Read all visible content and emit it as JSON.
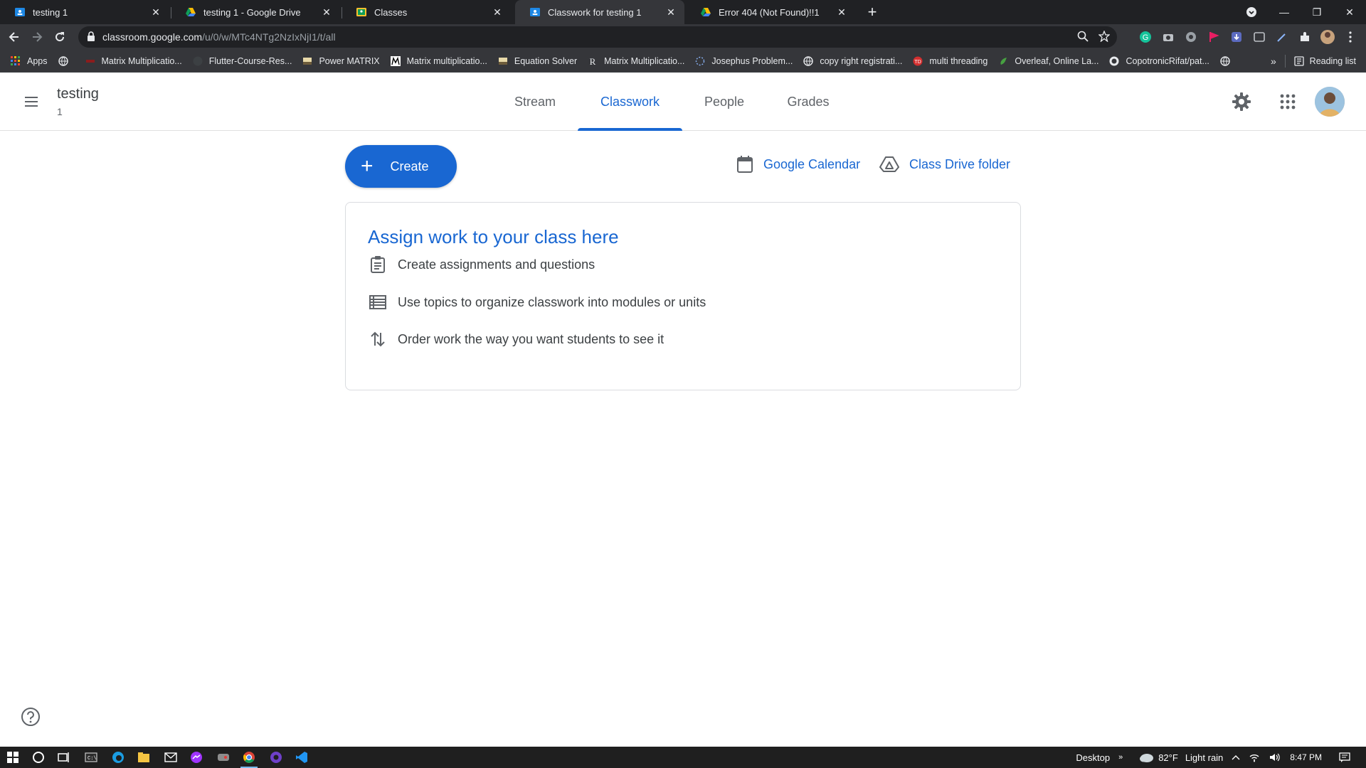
{
  "browser": {
    "tabs": [
      {
        "label": "testing 1",
        "icon": "classroom-favicon",
        "active": false
      },
      {
        "label": "testing 1 - Google Drive",
        "icon": "drive-favicon",
        "active": false
      },
      {
        "label": "Classes",
        "icon": "classroom-yellow-favicon",
        "active": false
      },
      {
        "label": "Classwork for testing 1",
        "icon": "classroom-favicon",
        "active": true
      },
      {
        "label": "Error 404 (Not Found)!!1",
        "icon": "drive-favicon",
        "active": false
      }
    ],
    "url_host": "classroom.google.com",
    "url_path": "/u/0/w/MTc4NTg2NzIxNjI1/t/all",
    "bookmarks": [
      {
        "label": "Apps",
        "icon": "apps-grid-icon"
      },
      {
        "label": "",
        "icon": "globe-icon"
      },
      {
        "label": "Matrix Multiplicatio...",
        "icon": "bookmark-favicon-red"
      },
      {
        "label": "Flutter-Course-Res...",
        "icon": "github-icon"
      },
      {
        "label": "Power MATRIX",
        "icon": "bookmark-favicon-folder"
      },
      {
        "label": "Matrix multiplicatio...",
        "icon": "bookmark-favicon-m"
      },
      {
        "label": "Equation Solver",
        "icon": "bookmark-favicon-folder"
      },
      {
        "label": "Matrix Multiplicatio...",
        "icon": "bookmark-favicon-r"
      },
      {
        "label": "Josephus Problem...",
        "icon": "bookmark-favicon-loading"
      },
      {
        "label": "copy right registrati...",
        "icon": "globe-icon"
      },
      {
        "label": "multi threading",
        "icon": "bookmark-favicon-td"
      },
      {
        "label": "Overleaf, Online La...",
        "icon": "overleaf-icon"
      },
      {
        "label": "CopotronicRifat/pat...",
        "icon": "github-icon"
      },
      {
        "label": "",
        "icon": "globe-icon"
      }
    ],
    "reading_list": "Reading list"
  },
  "classroom": {
    "class_name": "testing",
    "class_section": "1",
    "nav_tabs": [
      {
        "label": "Stream"
      },
      {
        "label": "Classwork"
      },
      {
        "label": "People"
      },
      {
        "label": "Grades"
      }
    ],
    "create_label": "Create",
    "plus": "+",
    "calendar_label": "Google Calendar",
    "drive_label": "Class Drive folder",
    "card": {
      "title": "Assign work to your class here",
      "rows": [
        {
          "text": "Create assignments and questions",
          "icon": "assignment-icon"
        },
        {
          "text": "Use topics to organize classwork into modules or units",
          "icon": "topic-list-icon"
        },
        {
          "text": "Order work the way you want students to see it",
          "icon": "reorder-arrows-icon"
        }
      ]
    },
    "accent": "#1967d2"
  },
  "taskbar": {
    "desktop_label": "Desktop",
    "temperature": "82°F",
    "weather": "Light rain",
    "time": "8:47 PM"
  }
}
